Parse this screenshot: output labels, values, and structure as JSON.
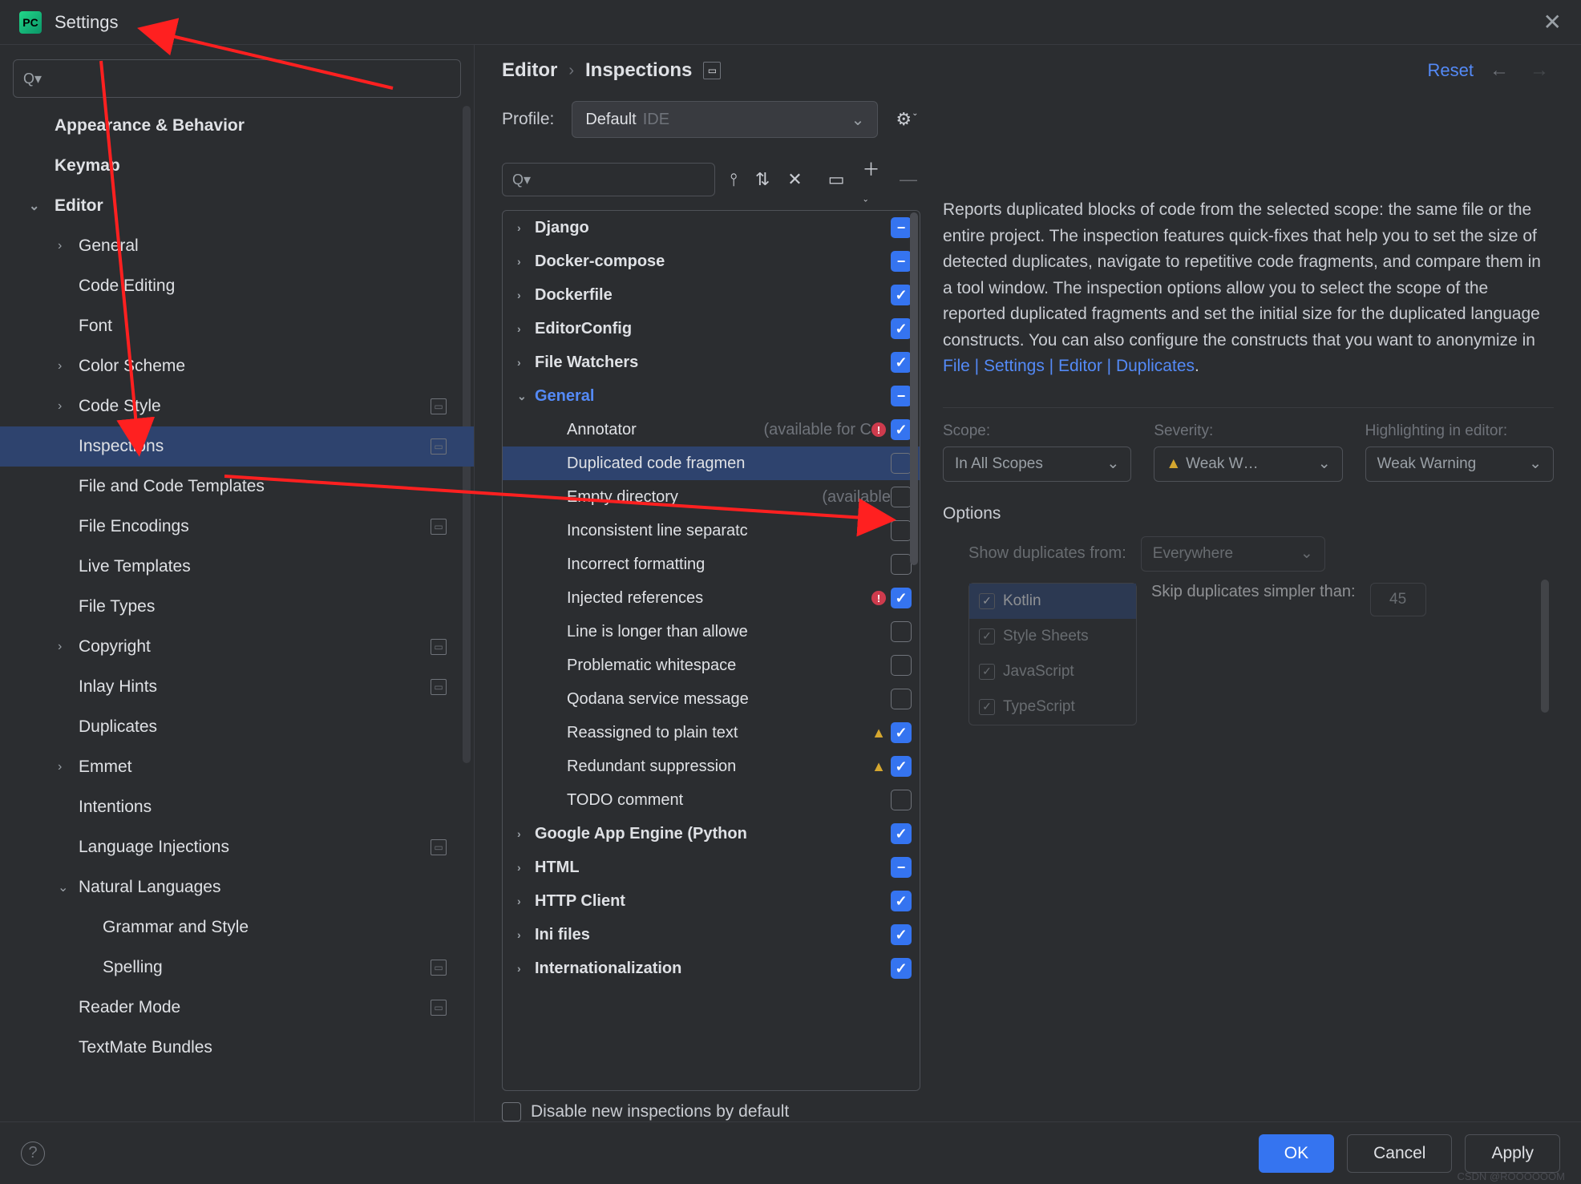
{
  "window": {
    "title": "Settings"
  },
  "sidebar": {
    "items": [
      {
        "label": "Appearance & Behavior",
        "top": true
      },
      {
        "label": "Keymap",
        "top": true
      },
      {
        "label": "Editor",
        "top": true,
        "expanded": true
      },
      {
        "label": "General",
        "child": true,
        "chev": true
      },
      {
        "label": "Code Editing",
        "child": true
      },
      {
        "label": "Font",
        "child": true
      },
      {
        "label": "Color Scheme",
        "child": true,
        "chev": true
      },
      {
        "label": "Code Style",
        "child": true,
        "chev": true,
        "badge": true
      },
      {
        "label": "Inspections",
        "child": true,
        "selected": true,
        "badge": true
      },
      {
        "label": "File and Code Templates",
        "child": true
      },
      {
        "label": "File Encodings",
        "child": true,
        "badge": true
      },
      {
        "label": "Live Templates",
        "child": true
      },
      {
        "label": "File Types",
        "child": true
      },
      {
        "label": "Copyright",
        "child": true,
        "chev": true,
        "badge": true
      },
      {
        "label": "Inlay Hints",
        "child": true,
        "badge": true
      },
      {
        "label": "Duplicates",
        "child": true
      },
      {
        "label": "Emmet",
        "child": true,
        "chev": true
      },
      {
        "label": "Intentions",
        "child": true
      },
      {
        "label": "Language Injections",
        "child": true,
        "badge": true
      },
      {
        "label": "Natural Languages",
        "child": true,
        "expanded": true
      },
      {
        "label": "Grammar and Style",
        "gchild": true
      },
      {
        "label": "Spelling",
        "gchild": true,
        "badge": true
      },
      {
        "label": "Reader Mode",
        "child": true,
        "badge": true
      },
      {
        "label": "TextMate Bundles",
        "child": true
      }
    ]
  },
  "breadcrumb": {
    "a": "Editor",
    "b": "Inspections",
    "reset": "Reset"
  },
  "profile": {
    "label": "Profile:",
    "value": "Default",
    "suffix": "IDE"
  },
  "inspTree": [
    {
      "label": "Django",
      "lvl": 1,
      "state": "partial"
    },
    {
      "label": "Docker-compose",
      "lvl": 1,
      "state": "partial"
    },
    {
      "label": "Dockerfile",
      "lvl": 1,
      "state": "check"
    },
    {
      "label": "EditorConfig",
      "lvl": 1,
      "state": "check"
    },
    {
      "label": "File Watchers",
      "lvl": 1,
      "state": "check"
    },
    {
      "label": "General",
      "lvl": 1,
      "state": "partial",
      "expanded": true,
      "gen": true
    },
    {
      "label": "Annotator",
      "note": "(available for C",
      "lvl": 2,
      "state": "check",
      "err": true
    },
    {
      "label": "Duplicated code fragmen",
      "lvl": 2,
      "state": "empty",
      "selected": true
    },
    {
      "label": "Empty directory",
      "note": "(available",
      "lvl": 2,
      "state": "empty"
    },
    {
      "label": "Inconsistent line separatc",
      "lvl": 2,
      "state": "empty"
    },
    {
      "label": "Incorrect formatting",
      "lvl": 2,
      "state": "empty"
    },
    {
      "label": "Injected references",
      "lvl": 2,
      "state": "check",
      "err": true
    },
    {
      "label": "Line is longer than allowe",
      "lvl": 2,
      "state": "empty"
    },
    {
      "label": "Problematic whitespace",
      "lvl": 2,
      "state": "empty"
    },
    {
      "label": "Qodana service message",
      "lvl": 2,
      "state": "empty"
    },
    {
      "label": "Reassigned to plain text",
      "lvl": 2,
      "state": "check",
      "warn": true
    },
    {
      "label": "Redundant suppression",
      "lvl": 2,
      "state": "check",
      "warn": true
    },
    {
      "label": "TODO comment",
      "lvl": 2,
      "state": "empty"
    },
    {
      "label": "Google App Engine (Python",
      "lvl": 1,
      "state": "check"
    },
    {
      "label": "HTML",
      "lvl": 1,
      "state": "partial"
    },
    {
      "label": "HTTP Client",
      "lvl": 1,
      "state": "check"
    },
    {
      "label": "Ini files",
      "lvl": 1,
      "state": "check"
    },
    {
      "label": "Internationalization",
      "lvl": 1,
      "state": "check"
    }
  ],
  "disableNew": "Disable new inspections by default",
  "description": {
    "text": "Reports duplicated blocks of code from the selected scope: the same file or the entire project. The inspection features quick-fixes that help you to set the size of detected duplicates, navigate to repetitive code fragments, and compare them in a tool window. The inspection options allow you to select the scope of the reported duplicated fragments and set the initial size for the duplicated language constructs. You can also configure the constructs that you want to anonymize in ",
    "link": "File | Settings | Editor | Duplicates"
  },
  "scope": {
    "label": "Scope:",
    "value": "In All Scopes"
  },
  "severity": {
    "label": "Severity:",
    "value": "Weak W…"
  },
  "highlighting": {
    "label": "Highlighting in editor:",
    "value": "Weak Warning"
  },
  "options": {
    "title": "Options",
    "showFrom": "Show duplicates from:",
    "showFromValue": "Everywhere",
    "langs": [
      "Kotlin",
      "Style Sheets",
      "JavaScript",
      "TypeScript"
    ],
    "skipLabel": "Skip duplicates simpler than:",
    "skipValue": "45"
  },
  "footer": {
    "ok": "OK",
    "cancel": "Cancel",
    "apply": "Apply"
  },
  "watermark": "CSDN @ROOOOOOM"
}
